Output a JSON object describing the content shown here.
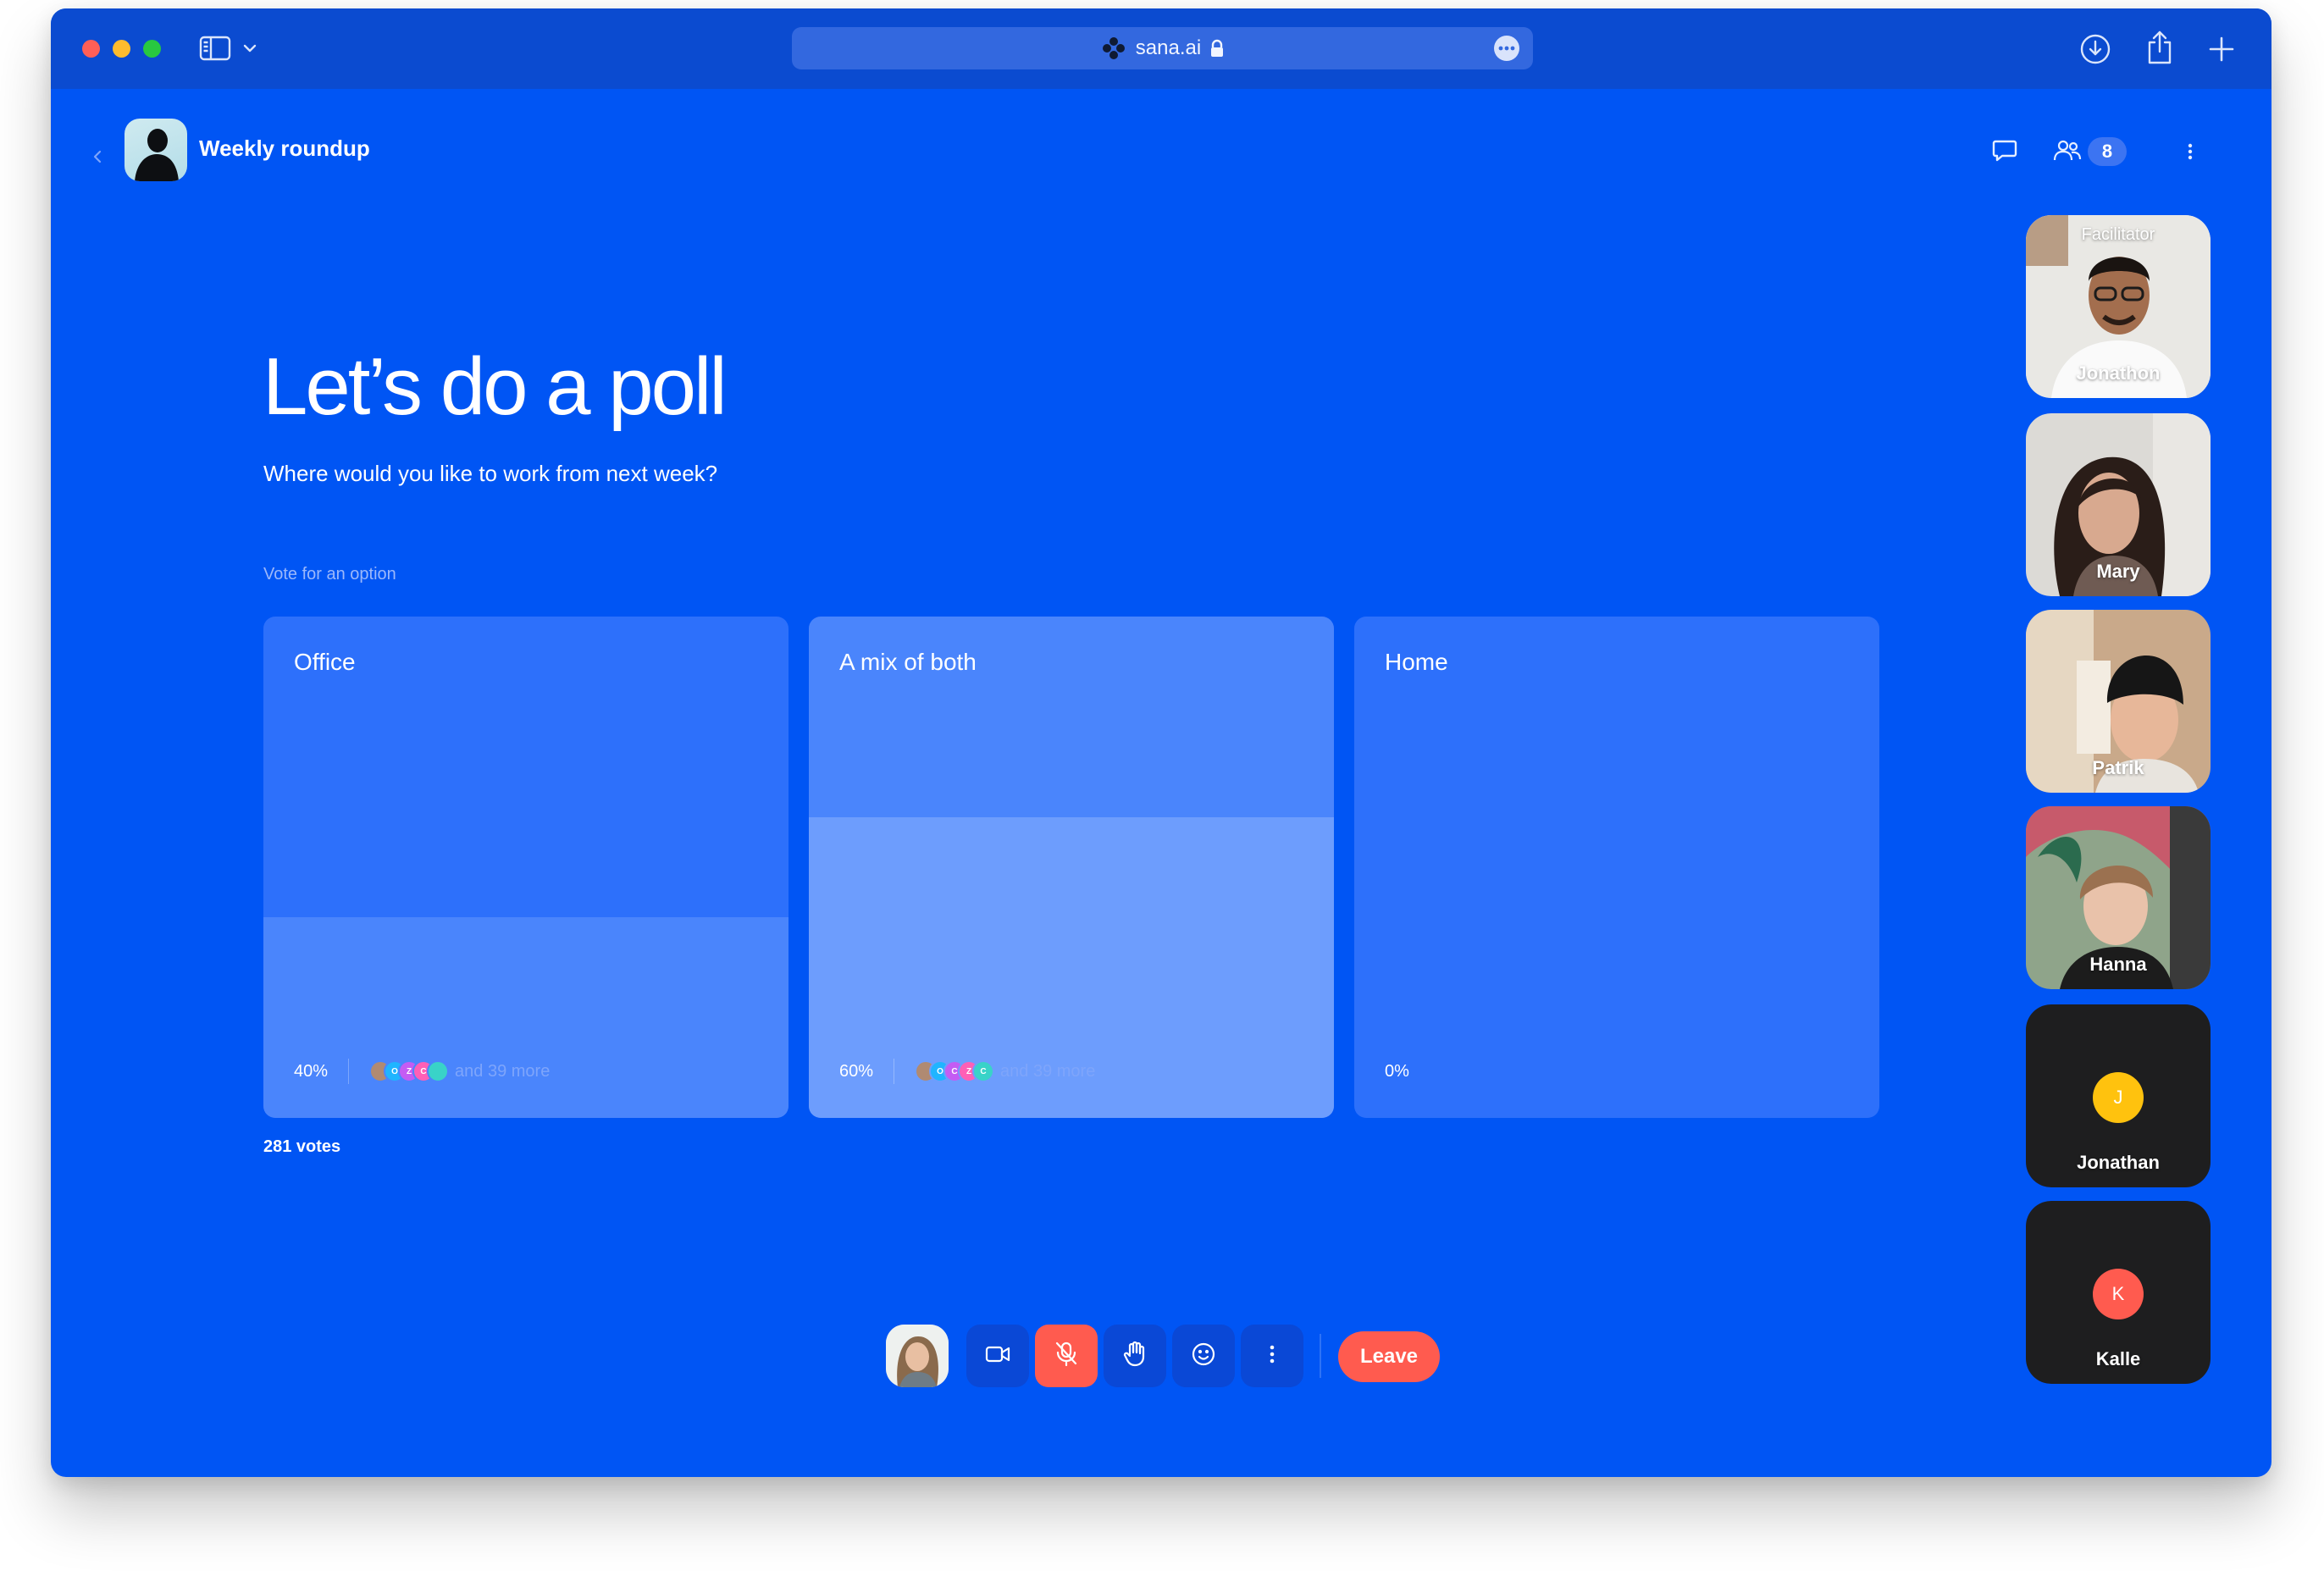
{
  "browser": {
    "address": "sana.ai"
  },
  "meeting": {
    "title": "Weekly roundup",
    "participant_count": "8"
  },
  "poll": {
    "title": "Let’s do a poll",
    "question": "Where would you like to work from next week?",
    "hint": "Vote for an option",
    "total_votes": "281 votes",
    "options": [
      {
        "label": "Office",
        "percent_text": "40%",
        "percent": 40,
        "voters_more": "and 39 more",
        "voter_initials": [
          "",
          "O",
          "Z",
          "C"
        ],
        "selected": false
      },
      {
        "label": "A mix of both",
        "percent_text": "60%",
        "percent": 60,
        "voters_more": "and 39 more",
        "voter_initials": [
          "",
          "O",
          "C",
          "Z",
          "C"
        ],
        "selected": true
      },
      {
        "label": "Home",
        "percent_text": "0%",
        "percent": 0,
        "voters_more": "",
        "voter_initials": [],
        "selected": false
      }
    ]
  },
  "participants": [
    {
      "name": "Jonathon",
      "role": "Facilitator",
      "video": true
    },
    {
      "name": "Mary",
      "role": "",
      "video": true
    },
    {
      "name": "Patrik",
      "role": "",
      "video": true
    },
    {
      "name": "Hanna",
      "role": "",
      "video": true
    },
    {
      "name": "Jonathan",
      "role": "",
      "video": false,
      "initial": "J",
      "color": "#ffc20e"
    },
    {
      "name": "Kalle",
      "role": "",
      "video": false,
      "initial": "K",
      "color": "#ff5b4f"
    }
  ],
  "controls": {
    "leave_label": "Leave",
    "icons": [
      "camera-icon",
      "mic-off-icon",
      "raise-hand-icon",
      "emoji-icon",
      "more-vertical-icon"
    ]
  },
  "colors": {
    "background": "#0055f4",
    "chrome": "#0b4bd0",
    "danger": "#ff5b4f",
    "accent_yellow": "#ffc20e"
  }
}
